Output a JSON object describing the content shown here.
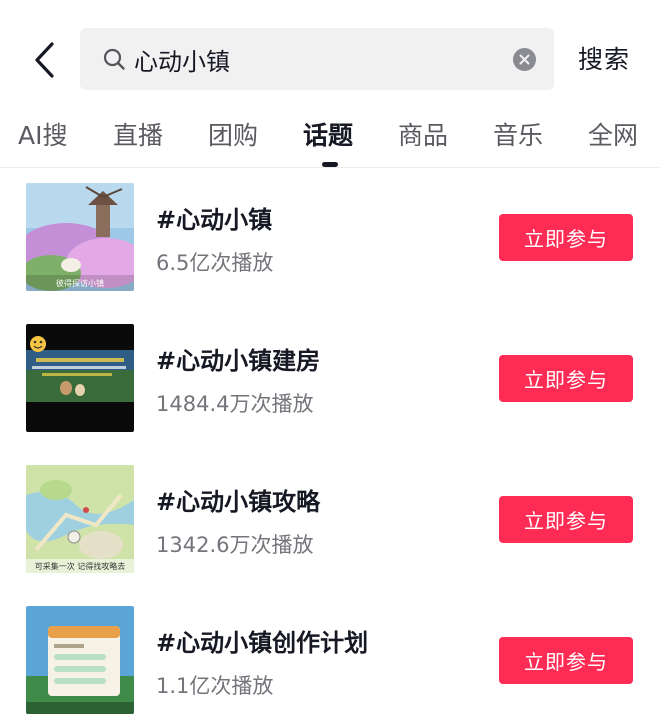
{
  "header": {
    "search_value": "心动小镇",
    "search_button_label": "搜索"
  },
  "tabs": [
    {
      "label": "AI搜",
      "active": false
    },
    {
      "label": "直播",
      "active": false
    },
    {
      "label": "团购",
      "active": false
    },
    {
      "label": "话题",
      "active": true
    },
    {
      "label": "商品",
      "active": false
    },
    {
      "label": "音乐",
      "active": false
    },
    {
      "label": "全网",
      "active": false
    }
  ],
  "results": [
    {
      "title": "#心动小镇",
      "plays": "6.5亿次播放",
      "button_label": "立即参与",
      "thumbnail_caption": "彼得探访小镇"
    },
    {
      "title": "#心动小镇建房",
      "plays": "1484.4万次播放",
      "button_label": "立即参与",
      "thumbnail_caption": ""
    },
    {
      "title": "#心动小镇攻略",
      "plays": "1342.6万次播放",
      "button_label": "立即参与",
      "thumbnail_caption": "可采集一次 记得找攻略去"
    },
    {
      "title": "#心动小镇创作计划",
      "plays": "1.1亿次播放",
      "button_label": "立即参与",
      "thumbnail_caption": ""
    }
  ],
  "colors": {
    "accent": "#fe2c55",
    "text_primary": "#161823",
    "text_secondary": "#74757b",
    "search_bg": "#f1f1f2"
  },
  "icons": {
    "back": "chevron-left-icon",
    "search": "search-icon",
    "clear": "clear-icon"
  }
}
